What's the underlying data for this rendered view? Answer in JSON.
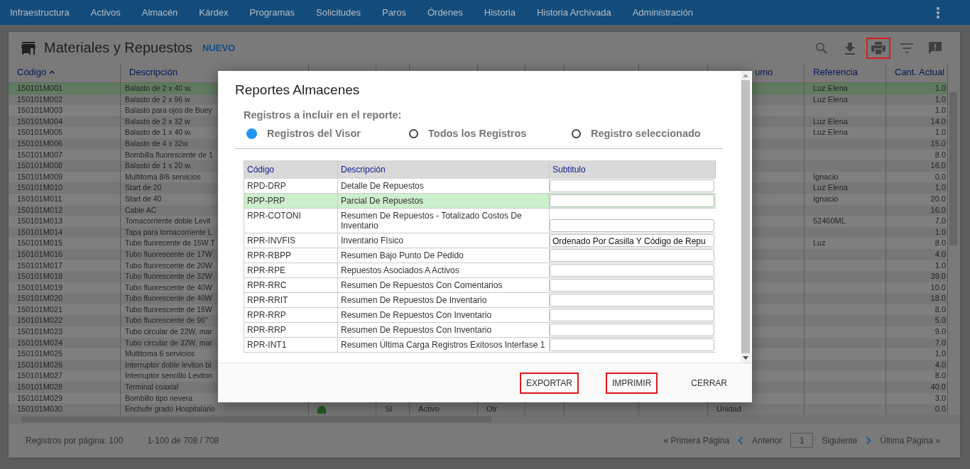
{
  "nav": {
    "items": [
      "Infraestructura",
      "Activos",
      "Almacén",
      "Kárdex",
      "Programas",
      "Solicitudes",
      "Paros",
      "Órdenes",
      "Historia",
      "Historia Archivada",
      "Administración"
    ]
  },
  "panel": {
    "title": "Materiales y Repuestos",
    "new_link": "NUEVO",
    "toolbar": [
      {
        "kind": "search",
        "highlighted": false
      },
      {
        "kind": "download",
        "highlighted": false
      },
      {
        "kind": "print",
        "highlighted": true
      },
      {
        "kind": "filter",
        "highlighted": false
      },
      {
        "kind": "feedback",
        "highlighted": false
      }
    ]
  },
  "table": {
    "columns": [
      {
        "label": "Código",
        "sorted": true
      },
      {
        "label": "Descripción"
      },
      {},
      {},
      {},
      {},
      {},
      {},
      {},
      {
        "label": "umo"
      },
      {
        "label": "Referencia"
      },
      {
        "label": "Cant. Actual"
      }
    ],
    "rows": [
      {
        "code": "150101M001",
        "description": "Balasto de 2 x 40 w.",
        "reference": "Luz Elena",
        "quantity": "1.0",
        "selected": true
      },
      {
        "code": "150101M002",
        "description": "Balasto de 2 x 96 w",
        "reference": "Luz Elena",
        "quantity": "1.0",
        "selected": false
      },
      {
        "code": "150101M003",
        "description": "Balasto para ojos de Buey",
        "quantity": "1.0",
        "selected": false
      },
      {
        "code": "150101M004",
        "description": "Balasto de 2 x 32 w",
        "reference": "Luz Elena",
        "quantity": "14.0",
        "selected": false
      },
      {
        "code": "150101M005",
        "description": "Balasto de 1 x 40 w.",
        "reference": "Luz Elena",
        "quantity": "1.0",
        "selected": false
      },
      {
        "code": "150101M006",
        "description": "Balasto de 4 x 32w",
        "quantity": "15.0",
        "selected": false
      },
      {
        "code": "150101M007",
        "description": "Bombilla fluorescente de 1",
        "quantity": "8.0",
        "selected": false
      },
      {
        "code": "150101M008",
        "description": "Balasto de 1 x 20 w.",
        "quantity": "16.0",
        "selected": false
      },
      {
        "code": "150101M009",
        "description": "Multitoma 8/6 servicios",
        "reference": "Ignacio",
        "quantity": "0.0",
        "selected": false
      },
      {
        "code": "150101M010",
        "description": "Start de 20",
        "reference": "Luz Elena",
        "quantity": "1.0",
        "selected": false
      },
      {
        "code": "150101M011",
        "description": "Start de 40",
        "reference": "Ignacio",
        "quantity": "20.0",
        "selected": false
      },
      {
        "code": "150101M012",
        "description": "Cable AC",
        "quantity": "16.0",
        "selected": false
      },
      {
        "code": "150101M013",
        "description": "Tomacorriente doble Levit",
        "reference": "52460ML",
        "quantity": "7.0",
        "selected": false
      },
      {
        "code": "150101M014",
        "description": "Tapa para tomacorriente L",
        "quantity": "1.0",
        "selected": false
      },
      {
        "code": "150101M015",
        "description": "Tubo fluorecente de 15W T",
        "reference": "Luz",
        "quantity": "8.0",
        "selected": false
      },
      {
        "code": "150101M016",
        "description": "Tubo fluorescente de 17W",
        "quantity": "4.0",
        "selected": false
      },
      {
        "code": "150101M017",
        "description": "Tubo fluorescente de 20W",
        "quantity": "1.0",
        "selected": false
      },
      {
        "code": "150101M018",
        "description": "Tubo fluorescente de 32W",
        "quantity": "39.0",
        "selected": false
      },
      {
        "code": "150101M019",
        "description": "Tubo fluorescente de 40W",
        "quantity": "10.0",
        "selected": false
      },
      {
        "code": "150101M020",
        "description": "Tubo fluorescente de 40W",
        "quantity": "18.0",
        "selected": false
      },
      {
        "code": "150101M021",
        "description": "Tubo fluorescente de 15W",
        "quantity": "8.0",
        "selected": false
      },
      {
        "code": "150101M022",
        "description": "Tubo fluorescente de 96\"",
        "quantity": "5.0",
        "selected": false
      },
      {
        "code": "150101M023",
        "description": "Tubo circular de 22W, mar",
        "quantity": "9.0",
        "selected": false
      },
      {
        "code": "150101M024",
        "description": "Tubo circular de 32W, mar",
        "quantity": "7.0",
        "selected": false
      },
      {
        "code": "150101M025",
        "description": "Multitoma 6 servicios",
        "quantity": "1.0",
        "selected": false
      },
      {
        "code": "150101M026",
        "description": "Interruptor doble leviton bl",
        "quantity": "4.0",
        "selected": false
      },
      {
        "code": "150101M027",
        "description": "Interruptor sencillo Leviton",
        "quantity": "8.0",
        "selected": false
      },
      {
        "code": "150101M028",
        "description": "Terminal coaxial",
        "quantity": "40.0",
        "selected": false
      },
      {
        "code": "150101M029",
        "description": "Bombillo tipo nevera",
        "quantity": "3.0",
        "selected": false
      },
      {
        "code": "150101M030",
        "description": "Enchufe grado Hospitalario",
        "indicator": {
          "color": "#1f5a22"
        },
        "inv": "SI",
        "status": "Activo",
        "tt": "Otr",
        "unit": "Unidad",
        "quantity": "0.0",
        "selected": false
      }
    ]
  },
  "footer": {
    "per_page": "Registros por página: 100",
    "range": "1-100 de 708 / 708",
    "first": "« Primera Página",
    "previous": "Anterior",
    "page": "1",
    "next": "Siguiente",
    "last": "Última Página »"
  },
  "dialog": {
    "title": "Reportes Almacenes",
    "scope_label": "Registros a incluir en el reporte:",
    "scope_options": [
      {
        "label": "Registros del Visor",
        "selected": true
      },
      {
        "label": "Todos los Registros",
        "selected": false
      },
      {
        "label": "Registro seleccionado",
        "selected": false
      }
    ],
    "columns": [
      "Código",
      "Descripción",
      "Subtitulo"
    ],
    "reports": [
      {
        "code": "RPD-DRP",
        "description": "Detalle De Repuestos",
        "selected": false
      },
      {
        "code": "RPP-PRP",
        "description": "Parcial De Repuestos",
        "selected": true
      },
      {
        "code": "RPR-COTONI",
        "description": "Resumen De Repuestos - Totalizado Costos De Inventario",
        "selected": false
      },
      {
        "code": "RPR-INVFIS",
        "description": "Inventario Físico",
        "subtitle": "Ordenado Por Casilla Y Código de Repu",
        "selected": false
      },
      {
        "code": "RPR-RBPP",
        "description": "Resumen Bajo Punto De Pedido",
        "selected": false
      },
      {
        "code": "RPR-RPE",
        "description": "Repuestos Asociados A Activos",
        "selected": false
      },
      {
        "code": "RPR-RRC",
        "description": "Resumen De Repuestos Con Comentarios",
        "selected": false
      },
      {
        "code": "RPR-RRIT",
        "description": "Resumen De Repuestos De Inventario",
        "selected": false
      },
      {
        "code": "RPR-RRP",
        "description": "Resumen De Repuestos Con Inventario",
        "selected": false
      },
      {
        "code": "RPR-RRP",
        "description": "Resumen De Repuestos Con Inventario",
        "selected": false
      },
      {
        "code": "RPR-INT1",
        "description": "Resumen Última Carga Registros Exitosos Interfase 1",
        "selected": false
      }
    ],
    "buttons": [
      {
        "label": "EXPORTAR",
        "highlighted": true
      },
      {
        "label": "IMPRIMIR",
        "highlighted": true
      },
      {
        "label": "CERRAR",
        "highlighted": false
      }
    ]
  }
}
